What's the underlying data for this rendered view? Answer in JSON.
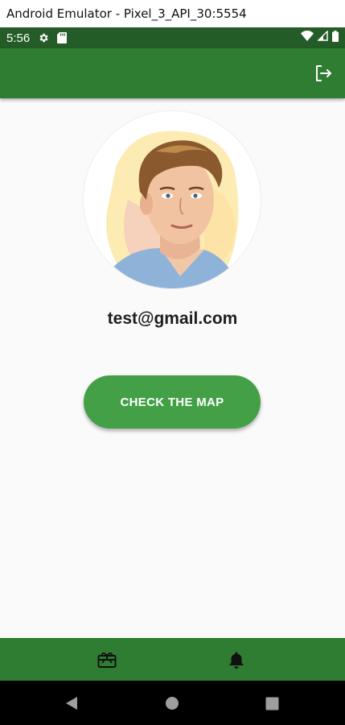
{
  "window": {
    "title": "Android Emulator - Pixel_3_API_30:5554"
  },
  "status_bar": {
    "time": "5:56",
    "icons": [
      "gear-icon",
      "sd-card-icon",
      "wifi-icon",
      "signal-icon",
      "battery-icon"
    ]
  },
  "app_bar": {
    "action_icon": "logout-icon"
  },
  "profile": {
    "avatar": "profile-photo",
    "email": "test@gmail.com"
  },
  "actions": {
    "map_button_label": "CHECK THE MAP"
  },
  "bottom_nav": {
    "items": [
      {
        "icon": "gift-card-icon"
      },
      {
        "icon": "bell-icon"
      }
    ]
  },
  "system_nav": {
    "items": [
      "back-icon",
      "home-icon",
      "recents-icon"
    ]
  },
  "colors": {
    "status_bar": "#245c28",
    "app_bar": "#2e7d32",
    "button": "#43a047",
    "background": "#fafafa"
  }
}
